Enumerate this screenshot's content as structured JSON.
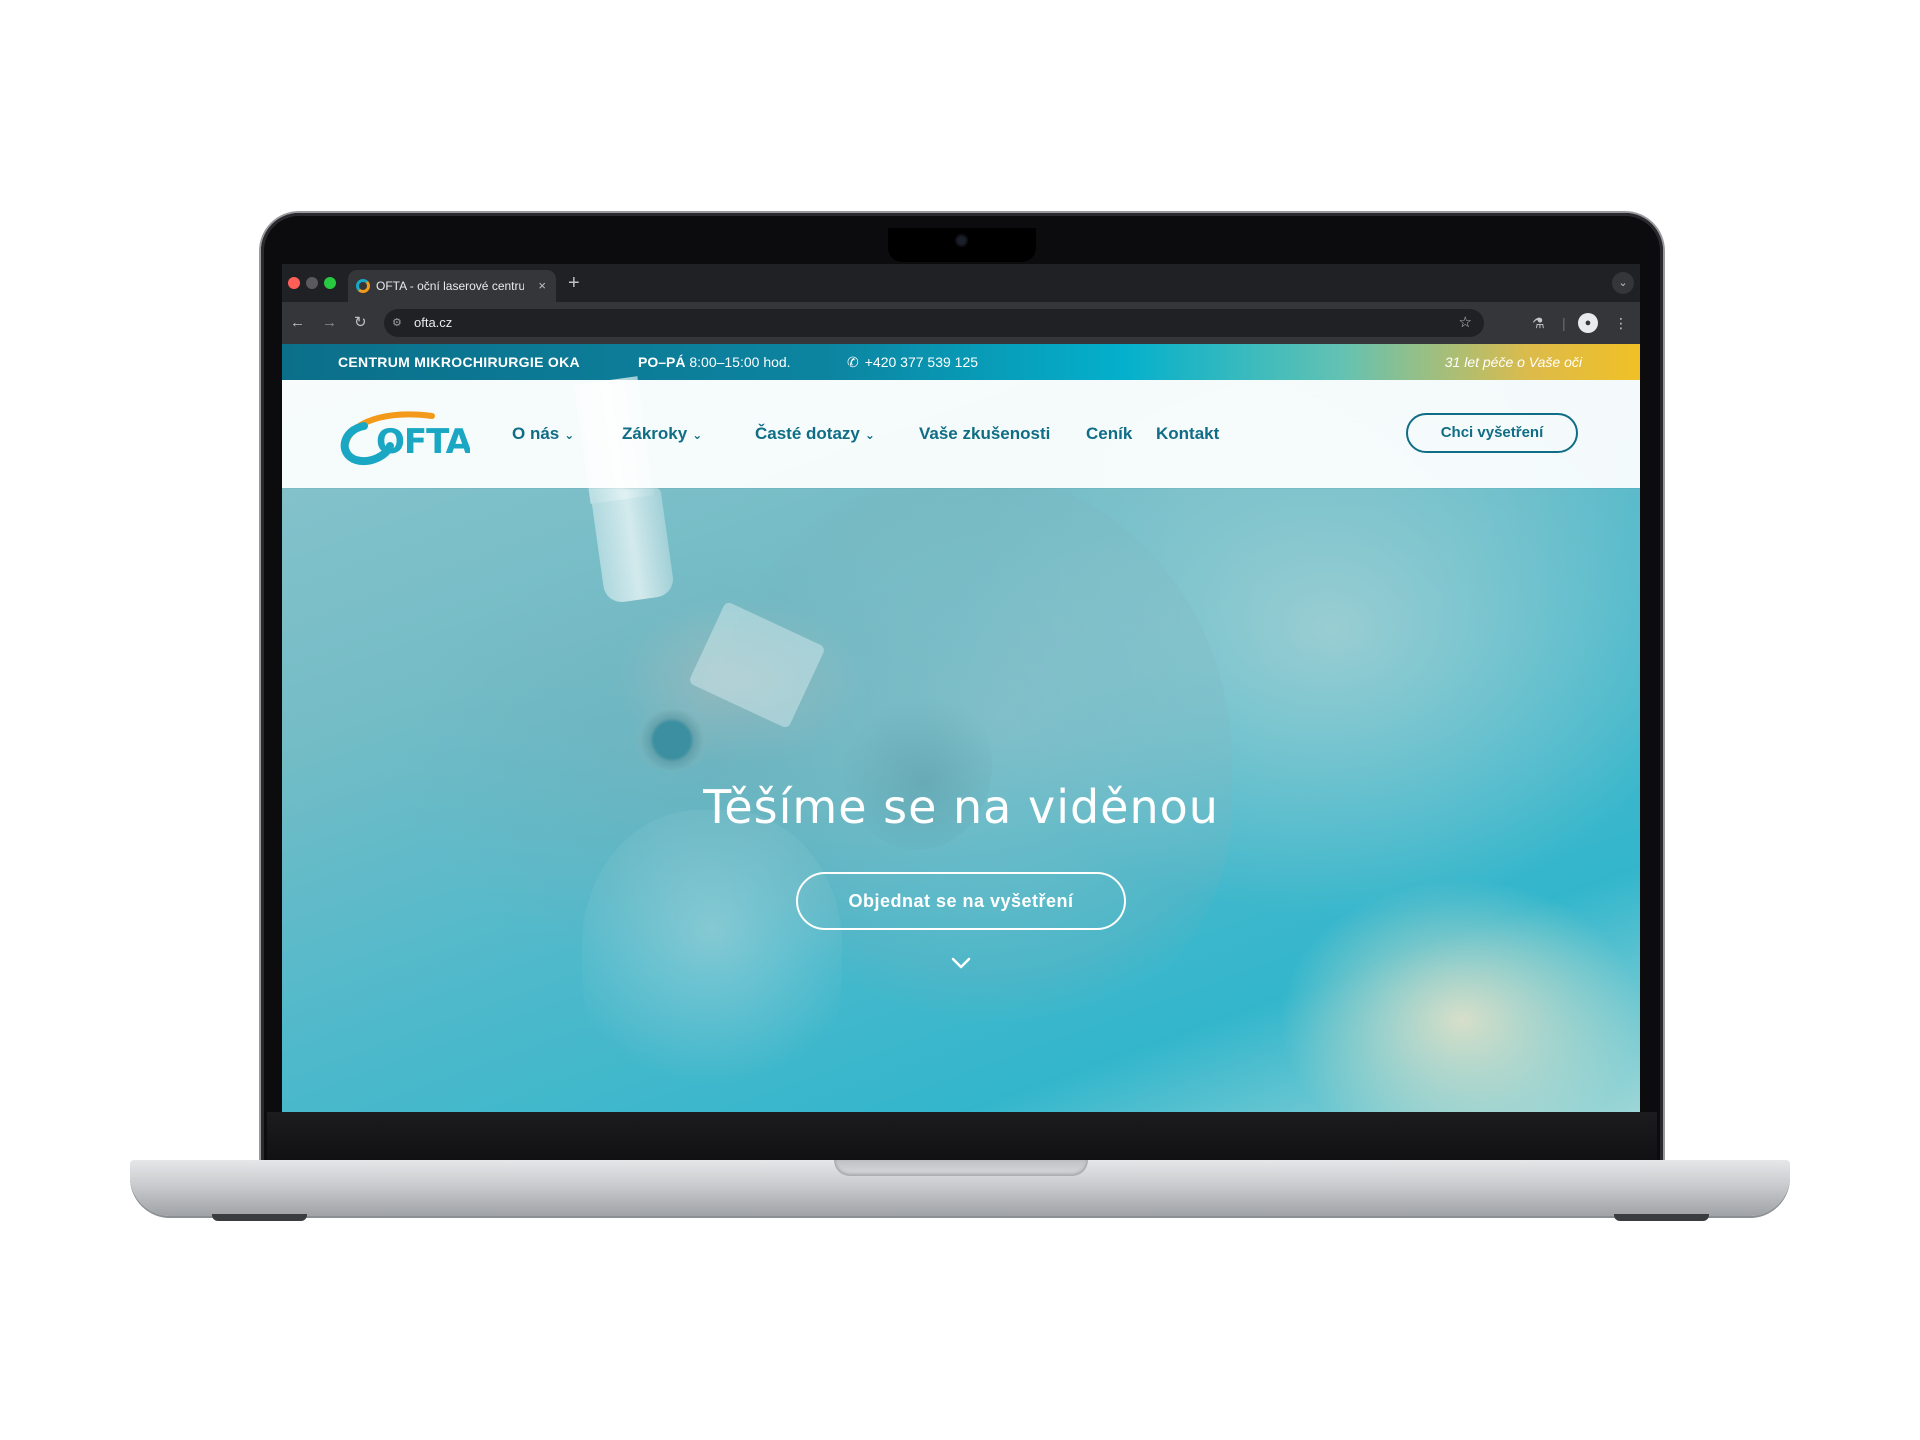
{
  "browser": {
    "tab_title": "OFTA - oční laserové centrum",
    "tab_close": "×",
    "new_tab": "+",
    "url": "ofta.cz",
    "icons": [
      "back-arrow-icon",
      "forward-arrow-icon",
      "reload-icon",
      "site-settings-icon",
      "bookmark-star-icon",
      "labs-flask-icon",
      "profile-icon",
      "more-menu-icon",
      "tab-list-chevron-icon"
    ]
  },
  "topbar": {
    "center_name": "CENTRUM MIKROCHIRURGIE OKA",
    "hours_days": "PO–PÁ",
    "hours_time": " 8:00–15:00 hod.",
    "phone": "+420 377 539 125",
    "slogan": "31 let péče o Vaše oči"
  },
  "header": {
    "logo_text": "OFTA",
    "nav": [
      {
        "label": "O nás",
        "has_dropdown": true
      },
      {
        "label": "Zákroky",
        "has_dropdown": true
      },
      {
        "label": "Časté dotazy",
        "has_dropdown": true
      },
      {
        "label": "Vaše zkušenosti",
        "has_dropdown": false
      },
      {
        "label": "Ceník",
        "has_dropdown": false
      },
      {
        "label": "Kontakt",
        "has_dropdown": false
      }
    ],
    "cta": "Chci vyšetření"
  },
  "hero": {
    "title": "Těšíme se na viděnou",
    "cta": "Objednat se na vyšetření"
  },
  "colors": {
    "brand_teal": "#0f6d86",
    "logo_orange": "#f39a1b",
    "logo_cyan": "#1aa7c4",
    "topbar_gold": "#f0c026"
  }
}
